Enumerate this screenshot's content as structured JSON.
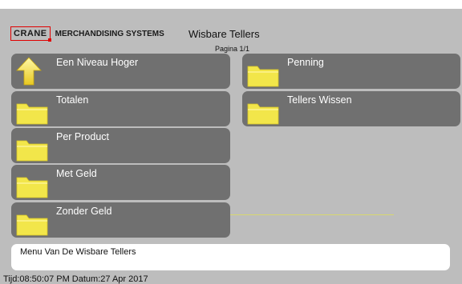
{
  "header": {
    "logo_brand": "CRANE",
    "logo_company": "MERCHANDISING SYSTEMS",
    "title": "Wisbare Tellers",
    "page_indicator": "Pagina 1/1"
  },
  "menu": {
    "left": [
      {
        "label": "Een Niveau Hoger",
        "icon": "up-arrow-icon"
      },
      {
        "label": "Totalen",
        "icon": "folder-icon"
      },
      {
        "label": "Per Product",
        "icon": "folder-icon"
      },
      {
        "label": "Met Geld",
        "icon": "folder-icon"
      },
      {
        "label": "Zonder Geld",
        "icon": "folder-icon"
      }
    ],
    "right": [
      {
        "label": "Penning",
        "icon": "folder-icon"
      },
      {
        "label": "Tellers Wissen",
        "icon": "folder-icon"
      }
    ]
  },
  "status": {
    "message": "Menu Van De Wisbare Tellers"
  },
  "footer": {
    "datetime": "Tijd:08:50:07 PM Datum:27 Apr 2017"
  },
  "colors": {
    "background": "#bdbdbd",
    "button": "#707070",
    "folder": "#f2e64a",
    "logo_accent": "#e00000"
  }
}
